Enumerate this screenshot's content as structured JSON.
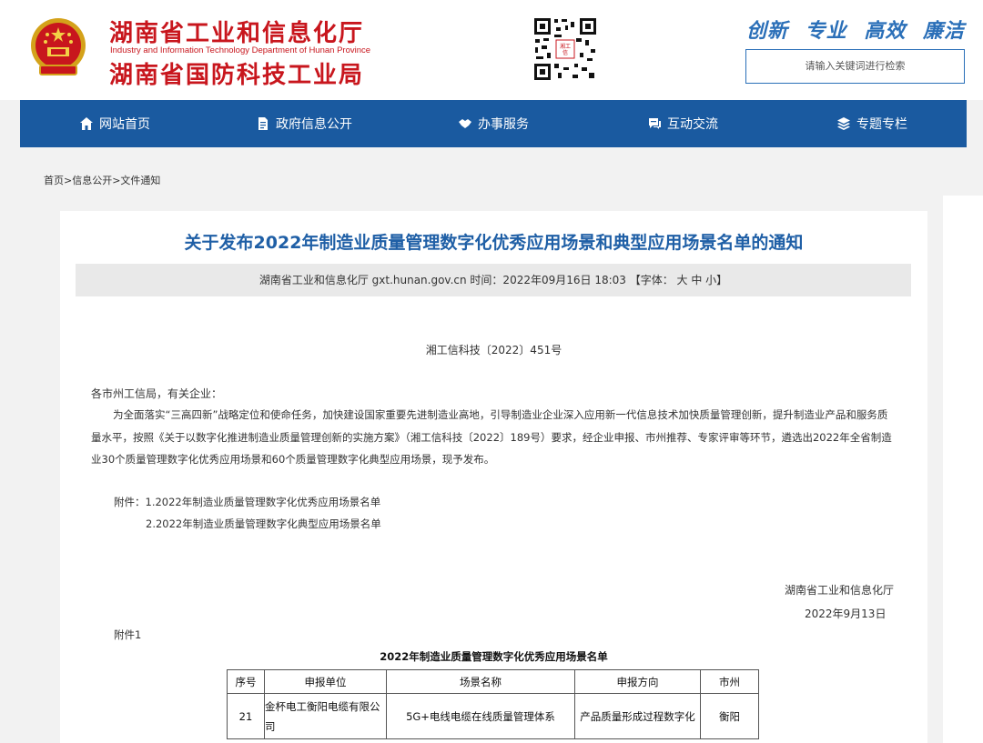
{
  "header": {
    "title_line1": "湖南省工业和信息化厅",
    "title_english": "Industry and Information Technology Department of Hunan Province",
    "title_line2": "湖南省国防科技工业局",
    "slogans": [
      "创新",
      "专业",
      "高效",
      "廉洁"
    ],
    "search_placeholder": "请输入关键词进行检索"
  },
  "nav": {
    "items": [
      {
        "label": "网站首页",
        "icon": "home-icon"
      },
      {
        "label": "政府信息公开",
        "icon": "document-icon"
      },
      {
        "label": "办事服务",
        "icon": "handshake-icon"
      },
      {
        "label": "互动交流",
        "icon": "chat-icon"
      },
      {
        "label": "专题专栏",
        "icon": "layers-icon"
      }
    ]
  },
  "breadcrumb": "首页>信息公开>文件通知",
  "article": {
    "title": "关于发布2022年制造业质量管理数字化优秀应用场景和典型应用场景名单的通知",
    "meta": "湖南省工业和信息化厅 gxt.hunan.gov.cn    时间：2022年09月16日 18:03    【字体：  大  中  小】",
    "doc_number": "湘工信科技〔2022〕451号",
    "salutation": "各市州工信局，有关企业：",
    "body": "为全面落实“三高四新”战略定位和使命任务，加快建设国家重要先进制造业高地，引导制造业企业深入应用新一代信息技术加快质量管理创新，提升制造业产品和服务质量水平，按照《关于以数字化推进制造业质量管理创新的实施方案》（湘工信科技〔2022〕189号）要求，经企业申报、市州推荐、专家评审等环节，遴选出2022年全省制造业30个质量管理数字化优秀应用场景和60个质量管理数字化典型应用场景，现予发布。",
    "attachment_1": "附件：1.2022年制造业质量管理数字化优秀应用场景名单",
    "attachment_2": "2.2022年制造业质量管理数字化典型应用场景名单",
    "signature_org": "湖南省工业和信息化厅",
    "signature_date": "2022年9月13日",
    "attachment_label": "附件1",
    "table_title": "2022年制造业质量管理数字化优秀应用场景名单",
    "table_headers": [
      "序号",
      "申报单位",
      "场景名称",
      "申报方向",
      "市州"
    ],
    "table_row": [
      "21",
      "金杯电工衡阳电缆有限公司",
      "5G+电线电缆在线质量管理体系",
      "产品质量形成过程数字化",
      "衡阳"
    ]
  }
}
